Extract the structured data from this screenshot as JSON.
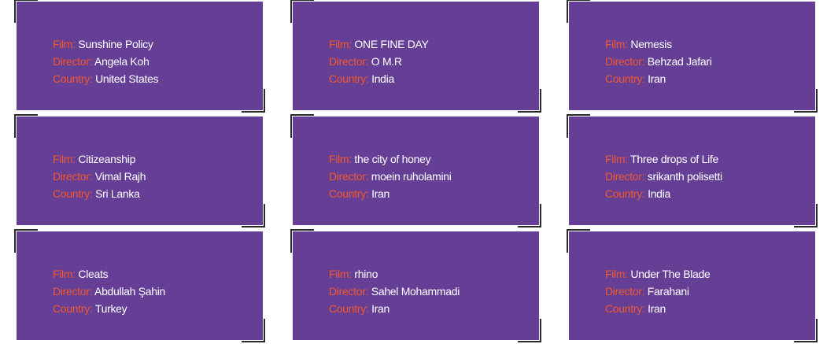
{
  "labels": {
    "film": "Film:",
    "director": "Director:",
    "country": "Country:"
  },
  "colors": {
    "card_background": "#643f95",
    "label_accent": "#f2572e",
    "value_text": "#ffffff",
    "corner_stroke": "#2a2a2a"
  },
  "cards": [
    {
      "film": "Sunshine Policy",
      "director": "Angela Koh",
      "country": "United States"
    },
    {
      "film": "ONE FINE DAY",
      "director": "O M.R",
      "country": "India"
    },
    {
      "film": "Nemesis",
      "director": "Behzad Jafari",
      "country": "Iran"
    },
    {
      "film": "Citizeanship",
      "director": "Vimal Rajh",
      "country": "Sri Lanka"
    },
    {
      "film": "the city of honey",
      "director": "moein ruholamini",
      "country": "Iran"
    },
    {
      "film": "Three drops of Life",
      "director": "srikanth polisetti",
      "country": "India"
    },
    {
      "film": "Cleats",
      "director": "Abdullah Şahin",
      "country": "Turkey"
    },
    {
      "film": "rhino",
      "director": "Sahel Mohammadi",
      "country": "Iran"
    },
    {
      "film": "Under The Blade",
      "director": "Farahani",
      "country": "Iran"
    }
  ]
}
